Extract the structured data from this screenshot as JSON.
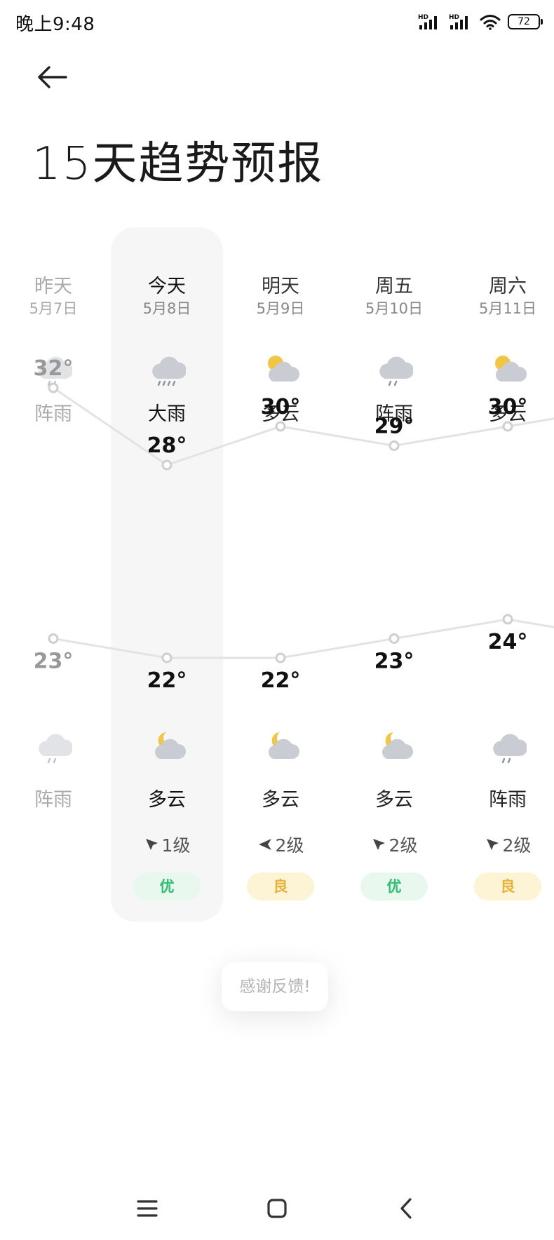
{
  "status_bar": {
    "time": "晚上9:48",
    "signal_icons": [
      "hd-signal-icon",
      "hd-signal-icon",
      "wifi-icon"
    ],
    "battery": "72"
  },
  "header": {
    "back_icon": "arrow-left-icon",
    "title": "15天趋势预报"
  },
  "days": [
    {
      "name": "昨天",
      "date": "5月7日",
      "day_icon": "rain-shower-icon",
      "day_weather": "阵雨",
      "high": 32,
      "high_label": "32°",
      "low": 23,
      "low_label": "23°",
      "night_icon": "rain-shower-icon",
      "night_weather": "阵雨",
      "wind": "",
      "aqi": "",
      "state": "past"
    },
    {
      "name": "今天",
      "date": "5月8日",
      "day_icon": "heavy-rain-icon",
      "day_weather": "大雨",
      "high": 28,
      "high_label": "28°",
      "low": 22,
      "low_label": "22°",
      "night_icon": "partly-cloudy-night-icon",
      "night_weather": "多云",
      "wind": "1级",
      "wind_dir": "northwest",
      "aqi": "优",
      "state": "today"
    },
    {
      "name": "明天",
      "date": "5月9日",
      "day_icon": "partly-cloudy-day-icon",
      "day_weather": "多云",
      "high": 30,
      "high_label": "30°",
      "low": 22,
      "low_label": "22°",
      "night_icon": "partly-cloudy-night-icon",
      "night_weather": "多云",
      "wind": "2级",
      "wind_dir": "west",
      "aqi": "良",
      "state": "future"
    },
    {
      "name": "周五",
      "date": "5月10日",
      "day_icon": "rain-shower-icon",
      "day_weather": "阵雨",
      "high": 29,
      "high_label": "29°",
      "low": 23,
      "low_label": "23°",
      "night_icon": "partly-cloudy-night-icon",
      "night_weather": "多云",
      "wind": "2级",
      "wind_dir": "northwest",
      "aqi": "优",
      "state": "future"
    },
    {
      "name": "周六",
      "date": "5月11日",
      "day_icon": "partly-cloudy-day-icon",
      "day_weather": "多云",
      "high": 30,
      "high_label": "30°",
      "low": 24,
      "low_label": "24°",
      "night_icon": "rain-shower-icon",
      "night_weather": "阵雨",
      "wind": "2级",
      "wind_dir": "northwest",
      "aqi": "良",
      "state": "future"
    }
  ],
  "next_day_partial": {
    "high": 31,
    "low": 23
  },
  "aqi_colors": {
    "优": {
      "bg": "#e8f8ef",
      "fg": "#2fbf71"
    },
    "良": {
      "bg": "#fdf4d6",
      "fg": "#e8b23a"
    }
  },
  "toast": "感谢反馈!",
  "nav_bar": {
    "menu_icon": "menu-icon",
    "home_icon": "home-square-icon",
    "back_icon": "chevron-left-icon"
  }
}
